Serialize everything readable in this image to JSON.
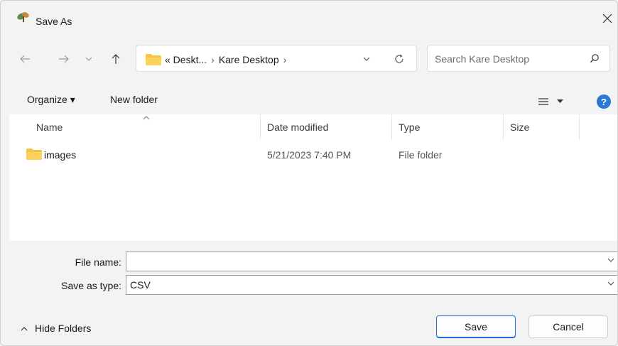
{
  "window": {
    "title": "Save As"
  },
  "address": {
    "crumbs": [
      "« Deskt...",
      "Kare Desktop"
    ],
    "separator": "›"
  },
  "search": {
    "placeholder": "Search Kare Desktop"
  },
  "commands": {
    "organize": "Organize ▾",
    "new_folder": "New folder"
  },
  "columns": {
    "name": "Name",
    "date": "Date modified",
    "type": "Type",
    "size": "Size"
  },
  "files": [
    {
      "name": "images",
      "date": "5/21/2023 7:40 PM",
      "type": "File folder",
      "size": ""
    }
  ],
  "form": {
    "file_name_label": "File name:",
    "file_name_value": "",
    "type_label": "Save as type:",
    "type_value": "CSV"
  },
  "footer": {
    "hide_folders": "Hide Folders",
    "save": "Save",
    "cancel": "Cancel"
  },
  "colors": {
    "accent": "#1d6fd6",
    "folder": "#f6c343",
    "help": "#2b79d7"
  }
}
